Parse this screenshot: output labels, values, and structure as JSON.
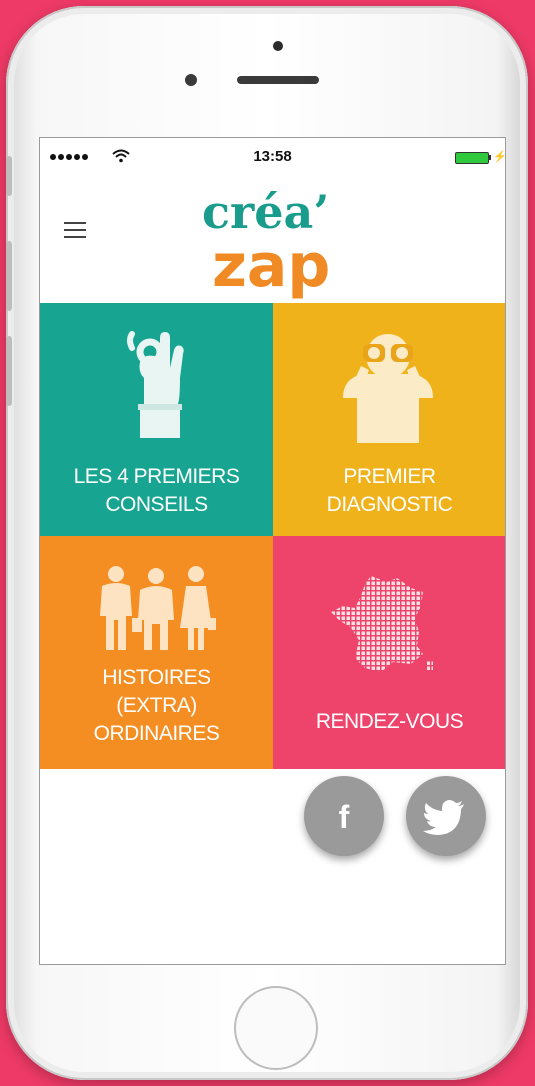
{
  "status_bar": {
    "time": "13:58"
  },
  "header": {
    "logo_top": "créa’",
    "logo_bottom": "zap",
    "menu_icon": "hamburger-menu-icon"
  },
  "tiles": [
    {
      "label_line1": "LES 4 PREMIERS",
      "label_line2": "CONSEILS",
      "color": "#17a592",
      "icon": "ok-hand-icon"
    },
    {
      "label_line1": "PREMIER",
      "label_line2": "DIAGNOSTIC",
      "color": "#f0b21b",
      "icon": "binoculars-person-icon"
    },
    {
      "label_line1": "HISTOIRES",
      "label_line2": "(EXTRA)",
      "label_line3": "ORDINAIRES",
      "color": "#f48e22",
      "icon": "people-icon"
    },
    {
      "label_line1": "RENDEZ-VOUS",
      "color": "#ee436b",
      "icon": "france-map-icon"
    }
  ],
  "social": {
    "facebook_label": "f",
    "facebook_icon": "facebook-icon",
    "twitter_icon": "twitter-bird-icon",
    "button_color": "#9a9a9a"
  },
  "colors": {
    "background": "#ee3a66",
    "logo_teal": "#1a9c8c",
    "logo_orange": "#f08a24"
  }
}
